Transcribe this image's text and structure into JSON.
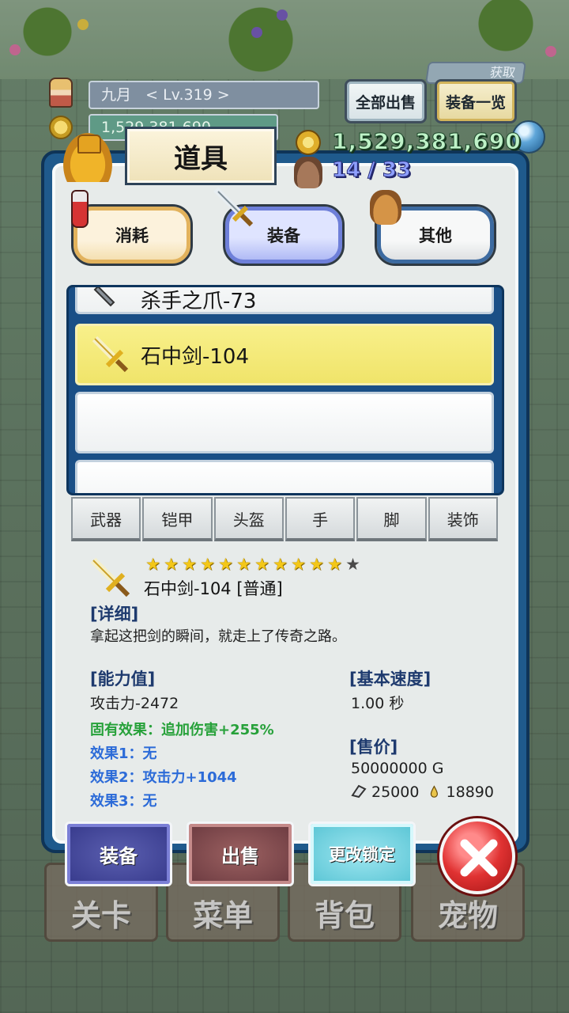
{
  "hud": {
    "player_name": "九月",
    "level": "< Lv.319 >",
    "money": "1,529,381,690",
    "acquire_badge": "获取",
    "sell_all_label": "全部出售",
    "equip_list_label": "装备一览"
  },
  "panel": {
    "title": "道具",
    "gold": "1,529,381,690",
    "capacity": "14 / 33"
  },
  "categories": {
    "consume": "消耗",
    "equip": "装备",
    "other": "其他"
  },
  "item_list": {
    "partial_item": "杀手之爪-73",
    "selected_item": "石中剑-104"
  },
  "equip_types": [
    "武器",
    "铠甲",
    "头盔",
    "手",
    "脚",
    "装饰"
  ],
  "detail": {
    "stars_filled": 11,
    "stars_total": 12,
    "name": "石中剑-104 [普通]",
    "detail_head": "[详细]",
    "description": "拿起这把剑的瞬间，就走上了传奇之路。",
    "ability_head": "[能力值]",
    "attack": "攻击力-2472",
    "inherent": "固有效果：追加伤害+255%",
    "effect1": "效果1：无",
    "effect2": "效果2：攻击力+1044",
    "effect3": "效果3：无",
    "speed_head": "[基本速度]",
    "speed": "1.00 秒",
    "price_head": "[售价]",
    "price": "50000000 G",
    "material_a": "25000",
    "material_b": "18890"
  },
  "actions": {
    "equip": "装备",
    "sell": "出售",
    "change_lock": "更改锁定"
  },
  "nav": {
    "stage": "关卡",
    "menu": "菜单",
    "bag": "背包",
    "pet": "宠物"
  },
  "colors": {
    "panel_blue": "#1f5a8c",
    "selected_slot": "#f3e97a",
    "gold_text": "#bff2c8",
    "capacity_text": "#8fa0ff",
    "effect_green": "#27a13a",
    "effect_blue": "#2c6bd8"
  }
}
